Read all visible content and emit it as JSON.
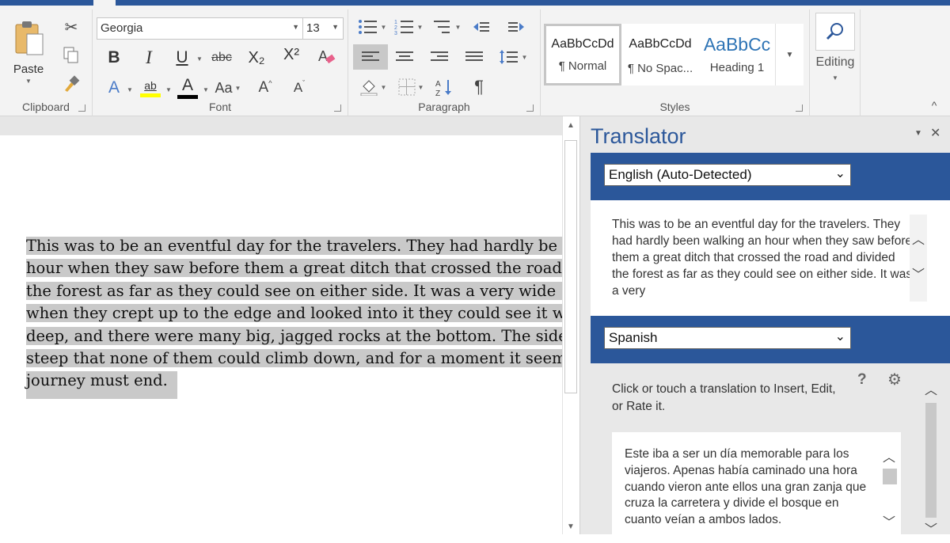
{
  "ribbon": {
    "clipboard": {
      "label": "Clipboard",
      "paste": "Paste"
    },
    "font": {
      "label": "Font",
      "font_name": "Georgia",
      "font_size": "13",
      "bold": "B",
      "italic": "I",
      "underline": "U",
      "strike": "abc",
      "subscript": "X₂",
      "superscript": "X²",
      "text_effects": "A",
      "highlight": "ab",
      "font_color": "A",
      "change_case": "Aa",
      "grow": "A",
      "shrink": "A"
    },
    "paragraph": {
      "label": "Paragraph",
      "pilcrow": "¶"
    },
    "styles": {
      "label": "Styles",
      "items": [
        {
          "preview": "AaBbCcDd",
          "name": "¶ Normal"
        },
        {
          "preview": "AaBbCcDd",
          "name": "¶ No Spac..."
        },
        {
          "preview": "AaBbCc",
          "name": "Heading 1"
        }
      ]
    },
    "editing": {
      "label": "Editing"
    }
  },
  "document": {
    "lines": [
      "This was to be an eventful day for the travelers. They had hardly be",
      "hour when they saw before them a great ditch that crossed the road",
      "the forest as far as they could see on either side. It was a very wide",
      "when they crept up to the edge and looked into it they could see it w",
      "deep, and there were many big, jagged rocks at the bottom. The side",
      "steep that none of them could climb down, and for a moment it seem",
      "journey must end."
    ]
  },
  "translator": {
    "title": "Translator",
    "source_language": "English (Auto-Detected)",
    "source_text": "This was to be an eventful day for the travelers. They had hardly been walking an hour when they saw before them a great ditch that crossed the road and divided the forest as far as they could see on either side. It was a very",
    "target_language": "Spanish",
    "hint": "Click or touch a translation to Insert, Edit, or Rate it.",
    "translation": "Este iba a ser un día memorable para los viajeros. Apenas había caminado una hora cuando vieron ante ellos una gran zanja que cruza la carretera y divide el bosque en cuanto veían a ambos lados."
  },
  "colors": {
    "accent": "#2b579a",
    "highlight_yellow": "#ffff00",
    "selection": "#c9c9c9"
  }
}
